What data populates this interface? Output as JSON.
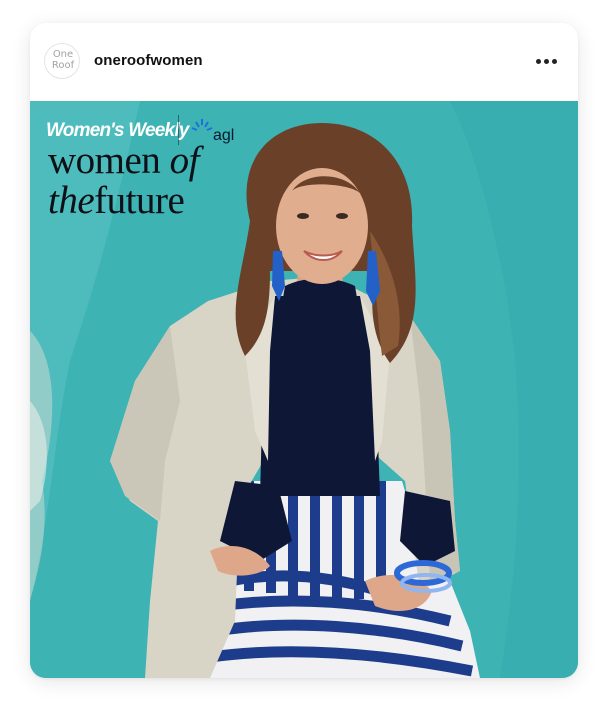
{
  "post": {
    "account": {
      "avatar_text": "One\nRoof",
      "username": "oneroofwomen"
    },
    "menu_icon": "more-horizontal-icon",
    "image": {
      "brand_primary": "Women's Weekly",
      "brand_partner": "agl",
      "title_line1_a": "women",
      "title_line1_b": "of",
      "title_line2_a": "the",
      "title_line2_b": "future"
    }
  },
  "colors": {
    "background_teal": "#3cb2b3",
    "text_dark": "#0d1017",
    "username": "#111111"
  }
}
